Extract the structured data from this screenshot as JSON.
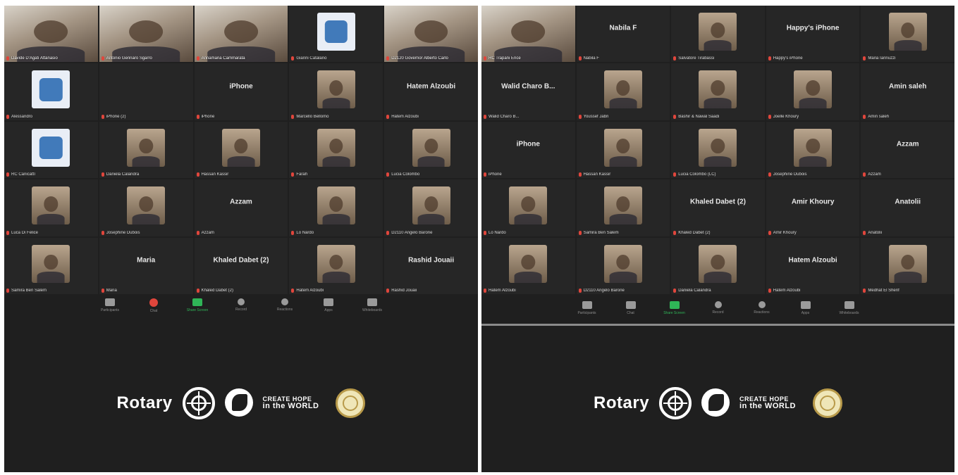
{
  "left": {
    "tiles": [
      {
        "type": "video",
        "name": "",
        "label": "Davide D'Agati Attanasio",
        "small": true
      },
      {
        "type": "video",
        "name": "",
        "label": "Antonio Gennaro Sgarro",
        "small": false,
        "active": true
      },
      {
        "type": "video",
        "name": "",
        "label": "Annamaria Cammarata",
        "small": false
      },
      {
        "type": "logo",
        "name": "",
        "label": "Gianni Catalano",
        "small": false
      },
      {
        "type": "video",
        "name": "",
        "label": "D2120 Governor Alberto Carlo",
        "small": false
      },
      {
        "type": "logo",
        "name": "",
        "label": "Alessandro",
        "small": false
      },
      {
        "type": "name",
        "name": "",
        "label": "iPhone (2)",
        "small": false
      },
      {
        "type": "name",
        "name": "iPhone",
        "label": "iPhone",
        "small": false
      },
      {
        "type": "photo",
        "name": "",
        "label": "Marcello Bellomo",
        "small": false
      },
      {
        "type": "name",
        "name": "Hatem Alzoubi",
        "label": "Hatem Alzoubi",
        "small": false
      },
      {
        "type": "logo",
        "name": "",
        "label": "RC Canicattì",
        "small": false
      },
      {
        "type": "photo",
        "name": "",
        "label": "Daniela Calandra",
        "small": false
      },
      {
        "type": "photo",
        "name": "",
        "label": "Hassan Kassir",
        "small": false
      },
      {
        "type": "photo",
        "name": "",
        "label": "Farah",
        "small": false
      },
      {
        "type": "photo",
        "name": "",
        "label": "Lucia Colombo",
        "small": false
      },
      {
        "type": "photo",
        "name": "",
        "label": "Luca Di Felice",
        "small": false
      },
      {
        "type": "photo",
        "name": "",
        "label": "Josephine Dubois",
        "small": false
      },
      {
        "type": "name",
        "name": "Azzam",
        "label": "Azzam",
        "small": false
      },
      {
        "type": "photo",
        "name": "",
        "label": "Lo Nardo",
        "small": false
      },
      {
        "type": "photo",
        "name": "",
        "label": "D2110 Angelo Barone",
        "small": false
      },
      {
        "type": "photo",
        "name": "",
        "label": "Samira Ben Salem",
        "small": false
      },
      {
        "type": "name",
        "name": "Maria",
        "label": "Maria",
        "small": false
      },
      {
        "type": "name",
        "name": "Khaled Dabet (2)",
        "label": "Khaled Dabet (2)",
        "small": false
      },
      {
        "type": "photo",
        "name": "",
        "label": "Hatem Alzoubi",
        "small": false
      },
      {
        "type": "name",
        "name": "Rashid Jouaii",
        "label": "Rashid Jouaii",
        "small": false
      }
    ],
    "toolbar": [
      {
        "icon": "participants-icon",
        "label": "Participants"
      },
      {
        "icon": "chat-icon",
        "label": "Chat"
      },
      {
        "icon": "share-screen-icon",
        "label": "Share Screen",
        "green": true
      },
      {
        "icon": "record-icon",
        "label": "Record"
      },
      {
        "icon": "reactions-icon",
        "label": "Reactions"
      },
      {
        "icon": "apps-icon",
        "label": "Apps"
      },
      {
        "icon": "whiteboards-icon",
        "label": "Whiteboards"
      }
    ]
  },
  "right": {
    "tiles": [
      {
        "type": "video",
        "name": "",
        "label": "RC Trapani Erice",
        "small": false
      },
      {
        "type": "name",
        "name": "Nabila F",
        "label": "Nabila F",
        "small": false
      },
      {
        "type": "photo",
        "name": "",
        "label": "Salvatore Tirabassi",
        "small": false
      },
      {
        "type": "name",
        "name": "Happy's iPhone",
        "label": "Happy's iPhone",
        "small": false
      },
      {
        "type": "photo",
        "name": "",
        "label": "Maria Iannuzzi",
        "small": false
      },
      {
        "type": "name",
        "name": "Walid Charo B...",
        "label": "Walid Charo B...",
        "small": false
      },
      {
        "type": "photo",
        "name": "",
        "label": "Youssef Jabri",
        "small": false
      },
      {
        "type": "photo",
        "name": "",
        "label": "Bashir & Nawal Saadi",
        "small": false
      },
      {
        "type": "photo",
        "name": "",
        "label": "Joelle Khoury",
        "small": false
      },
      {
        "type": "name",
        "name": "Amin saleh",
        "label": "Amin saleh",
        "small": false
      },
      {
        "type": "name",
        "name": "iPhone",
        "label": "iPhone",
        "small": false
      },
      {
        "type": "photo",
        "name": "",
        "label": "Hassan Kassir",
        "small": false
      },
      {
        "type": "photo",
        "name": "",
        "label": "Lucia Colombo (LC)",
        "small": false
      },
      {
        "type": "photo",
        "name": "",
        "label": "Josephine Dubois",
        "small": false
      },
      {
        "type": "name",
        "name": "Azzam",
        "label": "Azzam",
        "small": false
      },
      {
        "type": "photo",
        "name": "",
        "label": "Lo Nardo",
        "small": false
      },
      {
        "type": "photo",
        "name": "",
        "label": "Samira Ben Salem",
        "small": false
      },
      {
        "type": "name",
        "name": "Khaled Dabet (2)",
        "label": "Khaled Dabet (2)",
        "small": false
      },
      {
        "type": "name",
        "name": "Amir Khoury",
        "label": "Amir Khoury",
        "small": false
      },
      {
        "type": "name",
        "name": "Anatolii",
        "label": "Anatolii",
        "small": false
      },
      {
        "type": "photo",
        "name": "",
        "label": "Hatem Alzoubi",
        "small": false
      },
      {
        "type": "photo",
        "name": "",
        "label": "D2110 Angelo Barone",
        "small": false
      },
      {
        "type": "photo",
        "name": "",
        "label": "Daniela Calandra",
        "small": false
      },
      {
        "type": "name",
        "name": "Hatem Alzoubi",
        "label": "Hatem Alzoubi",
        "small": false
      },
      {
        "type": "photo",
        "name": "",
        "label": "Medhat El Sherif",
        "small": false
      }
    ],
    "toolbar": [
      {
        "icon": "participants-icon",
        "label": "Participants"
      },
      {
        "icon": "chat-icon",
        "label": "Chat"
      },
      {
        "icon": "share-screen-icon",
        "label": "Share Screen",
        "green": true
      },
      {
        "icon": "record-icon",
        "label": "Record"
      },
      {
        "icon": "reactions-icon",
        "label": "Reactions"
      },
      {
        "icon": "apps-icon",
        "label": "Apps"
      },
      {
        "icon": "whiteboards-icon",
        "label": "Whiteboards"
      }
    ]
  },
  "brand": {
    "rotary": "Rotary",
    "create_hope_line1": "CREATE HOPE",
    "create_hope_line2": "in the WORLD"
  },
  "colors": {
    "background": "#1f1f1f",
    "tile": "#262626",
    "accent_green": "#2fb557",
    "mic_red": "#e0463c",
    "active_speaker": "#d6e36a"
  }
}
